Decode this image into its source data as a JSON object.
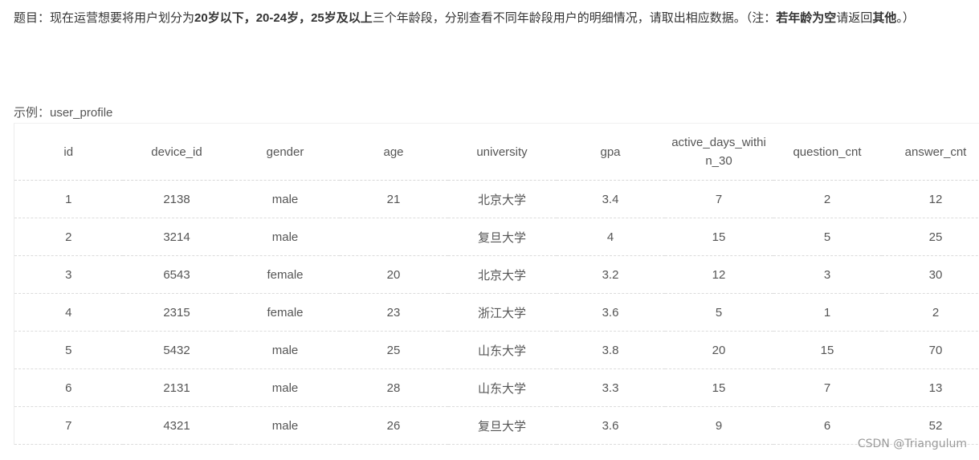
{
  "problem": {
    "segments": [
      {
        "text": "题目：现在运营想要将用户划分为",
        "bold": false
      },
      {
        "text": "20岁以下，20-24岁，25岁及以上",
        "bold": true
      },
      {
        "text": "三个年龄段，分别查看不同年龄段用户的明细情况，请取出相应数据。（注：",
        "bold": false
      },
      {
        "text": "若",
        "bold": true
      },
      {
        "text": "年龄为空",
        "bold": true
      },
      {
        "text": "请返回",
        "bold": false
      },
      {
        "text": "其他",
        "bold": true
      },
      {
        "text": "。）",
        "bold": false
      }
    ]
  },
  "example_label": "示例：user_profile",
  "table": {
    "headers": [
      "id",
      "device_id",
      "gender",
      "age",
      "university",
      "gpa",
      "active_days_within_30",
      "question_cnt",
      "answer_cnt"
    ],
    "rows": [
      [
        "1",
        "2138",
        "male",
        "21",
        "北京大学",
        "3.4",
        "7",
        "2",
        "12"
      ],
      [
        "2",
        "3214",
        "male",
        "",
        "复旦大学",
        "4",
        "15",
        "5",
        "25"
      ],
      [
        "3",
        "6543",
        "female",
        "20",
        "北京大学",
        "3.2",
        "12",
        "3",
        "30"
      ],
      [
        "4",
        "2315",
        "female",
        "23",
        "浙江大学",
        "3.6",
        "5",
        "1",
        "2"
      ],
      [
        "5",
        "5432",
        "male",
        "25",
        "山东大学",
        "3.8",
        "20",
        "15",
        "70"
      ],
      [
        "6",
        "2131",
        "male",
        "28",
        "山东大学",
        "3.3",
        "15",
        "7",
        "13"
      ],
      [
        "7",
        "4321",
        "male",
        "26",
        "复旦大学",
        "3.6",
        "9",
        "6",
        "52"
      ]
    ]
  },
  "watermark": "CSDN @Triangulum"
}
